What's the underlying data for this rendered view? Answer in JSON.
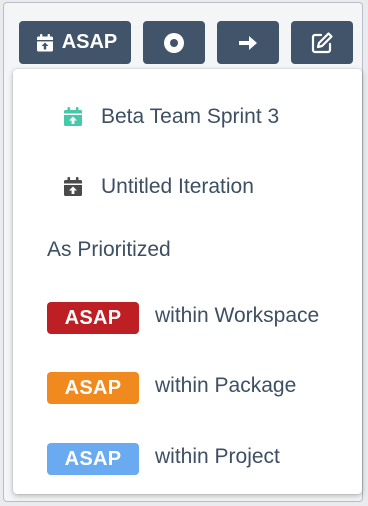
{
  "toolbar": {
    "asap_label": "ASAP",
    "button_color": "#41546a"
  },
  "menu": {
    "iterations": [
      {
        "label": "Beta Team Sprint 3",
        "icon": "calendar-upload-icon",
        "icon_color": "#46c9a8"
      },
      {
        "label": "Untitled Iteration",
        "icon": "calendar-upload-icon",
        "icon_color": "#4a4a4a"
      }
    ],
    "section_title": "As Prioritized",
    "priorities": [
      {
        "badge": "ASAP",
        "text": "within Workspace",
        "color": "#be1f24"
      },
      {
        "badge": "ASAP",
        "text": "within Package",
        "color": "#f08a1f"
      },
      {
        "badge": "ASAP",
        "text": "within Project",
        "color": "#6aaaf0"
      }
    ]
  }
}
